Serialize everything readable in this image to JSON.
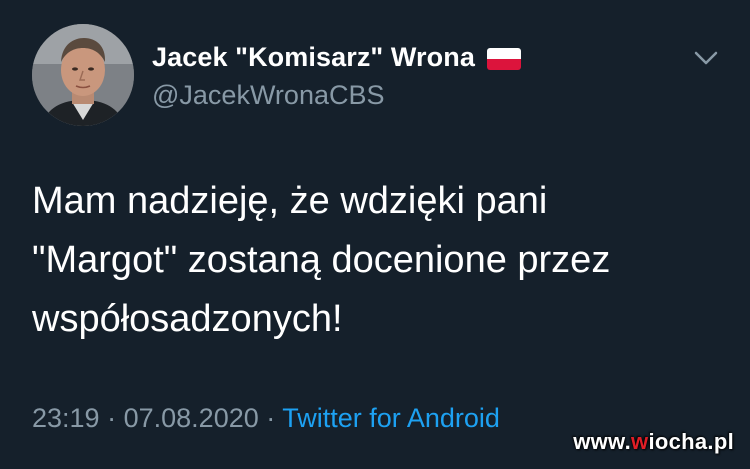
{
  "tweet": {
    "display_name": "Jacek \"Komisarz\" Wrona",
    "flag_icon": "poland-flag-icon",
    "handle": "@JacekWronaCBS",
    "text": "Mam nadzieję, że wdzięki pani\n\"Margot\" zostaną docenione przez\nwspółosadzonych!",
    "time": "23:19",
    "separator": "·",
    "date": "07.08.2020",
    "source": "Twitter for Android",
    "menu_icon": "chevron-down-icon"
  },
  "watermark": {
    "prefix": "www.",
    "accent": "w",
    "rest": "iocha.pl"
  },
  "colors": {
    "background": "#15202b",
    "secondary_text": "#8899a6",
    "link": "#1da1f2",
    "primary_text": "#ffffff"
  }
}
